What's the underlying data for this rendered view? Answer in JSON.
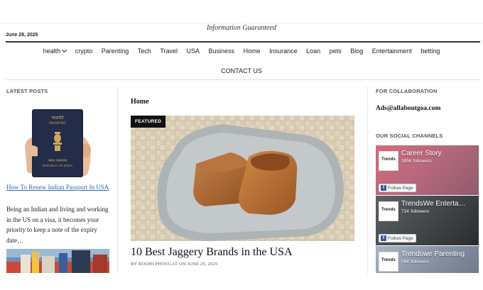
{
  "header": {
    "tagline": "Information Guaranteed",
    "date": "June 28, 2025"
  },
  "nav": {
    "items": [
      "health",
      "crypto",
      "Parenting",
      "Tech",
      "Travel",
      "USA",
      "Business",
      "Home",
      "Insurance",
      "Loan",
      "pets",
      "Blog",
      "Entertainment",
      "betting"
    ],
    "contact": "CONTACT US"
  },
  "left": {
    "section_title": "LATEST POSTS",
    "post_title": "How To Renew Indian Passport In USA",
    "excerpt": "Being an Indian and living and working in the US on a visa, it becomes your priority to keep a note of the expiry date…",
    "passport_top": "पासपोर्ट",
    "passport_word": "PASSPORT",
    "passport_country_hi": "भारत गणराज्य",
    "passport_country": "REPUBLIC OF INDIA"
  },
  "center": {
    "breadcrumb": "Home",
    "badge": "FEATURED",
    "title": "10 Best Jaggery Brands in the USA",
    "byline": "BY ROOHI PHOUGAT ON JUNE 25, 2025"
  },
  "right": {
    "collab_title": "FOR COLLABORATION",
    "email": "Ads@allaboutgoa.com",
    "social_title": "OUR SOCIAL CHANNELS",
    "cards": [
      {
        "thumb": "Trends",
        "name": "Career Story",
        "followers": "185K followers",
        "button": "Follow Page"
      },
      {
        "thumb": "Trends",
        "name": "TrendsWe Enterta…",
        "followers": "71K followers",
        "button": "Follow Page"
      },
      {
        "thumb": "Trends",
        "name": "Trendswe Parenting",
        "followers": "59K followers",
        "button": ""
      }
    ]
  },
  "colors": {
    "link": "#2a6db5",
    "facebook": "#3b5998",
    "badge_bg": "#111111"
  }
}
